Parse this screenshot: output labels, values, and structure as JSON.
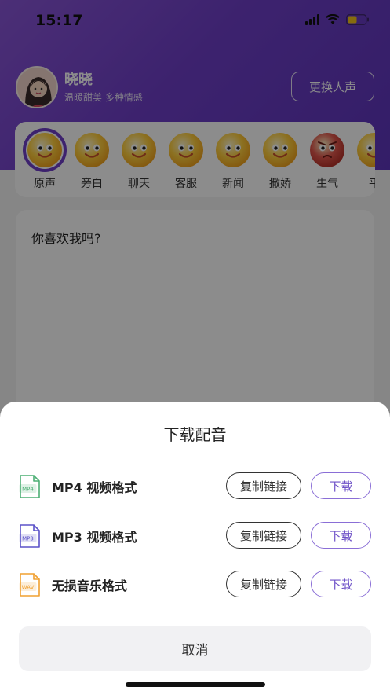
{
  "status_bar": {
    "time": "15:17"
  },
  "profile": {
    "name": "晓晓",
    "description": "温暖甜美 多种情感",
    "change_voice_label": "更换人声"
  },
  "emotions": [
    {
      "label": "原声",
      "selected": true,
      "mood": "happy"
    },
    {
      "label": "旁白",
      "selected": false,
      "mood": "happy"
    },
    {
      "label": "聊天",
      "selected": false,
      "mood": "happy"
    },
    {
      "label": "客服",
      "selected": false,
      "mood": "happy"
    },
    {
      "label": "新闻",
      "selected": false,
      "mood": "happy"
    },
    {
      "label": "撒娇",
      "selected": false,
      "mood": "happy"
    },
    {
      "label": "生气",
      "selected": false,
      "mood": "angry"
    },
    {
      "label": "平",
      "selected": false,
      "mood": "happy"
    }
  ],
  "text_input": {
    "content": "你喜欢我吗?"
  },
  "sheet": {
    "title": "下载配音",
    "formats": [
      {
        "icon_text": "MP4",
        "label": "MP4 视频格式",
        "copy_label": "复制链接",
        "download_label": "下载",
        "color": "#4caf74"
      },
      {
        "icon_text": "MP3",
        "label": "MP3 视频格式",
        "copy_label": "复制链接",
        "download_label": "下载",
        "color": "#5b52c9"
      },
      {
        "icon_text": "WAV",
        "label": "无损音乐格式",
        "copy_label": "复制链接",
        "download_label": "下载",
        "color": "#f0a030"
      }
    ],
    "cancel_label": "取消"
  },
  "colors": {
    "accent": "#6f3fc9",
    "download_border": "#8a6ed6"
  }
}
